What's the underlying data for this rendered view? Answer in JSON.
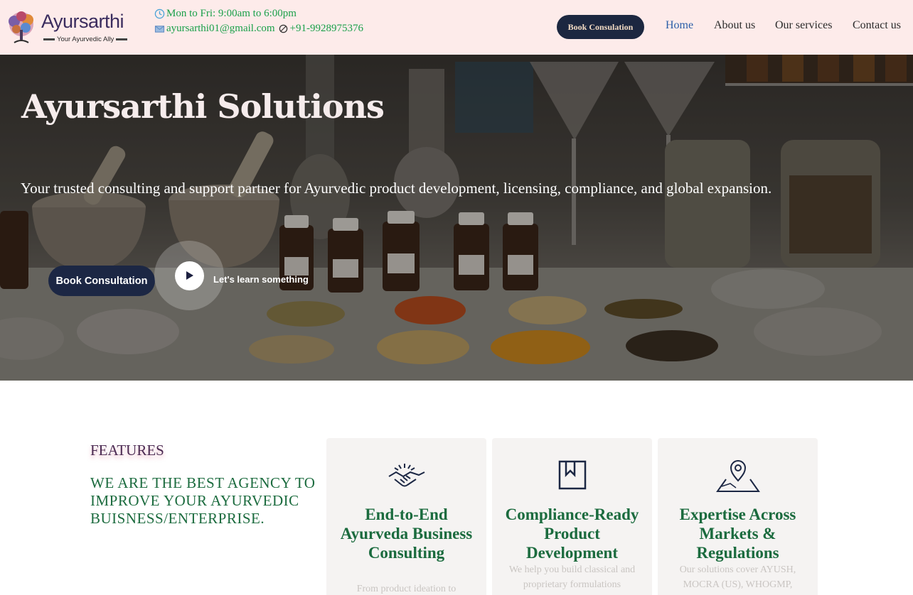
{
  "header": {
    "logo_word": "Ayursarthi",
    "logo_tagline": "Your Ayurvedic Ally",
    "hours": "Mon to Fri: 9:00am to 6:00pm",
    "email": "ayursarthi01@gmail.com",
    "phone": "+91-9928975376",
    "book_button": "Book Consulation",
    "nav": [
      "Home",
      "About us",
      "Our services",
      "Contact us"
    ],
    "active_nav": "Home"
  },
  "hero": {
    "title": "Ayursarthi Solutions",
    "subtitle": "Your trusted consulting and support partner for Ayurvedic product development, licensing, compliance, and global expansion.",
    "button": "Book Consultation",
    "learn_text": "Let's learn something"
  },
  "features": {
    "label": "FEATURES",
    "heading": "WE ARE THE BEST AGENCY TO IMPROVE YOUR AYURVEDIC BUISNESS/ENTERPRISE.",
    "cards": [
      {
        "icon": "handshake-icon",
        "title": "End-to-End Ayurveda Business Consulting",
        "text": "From product ideation to"
      },
      {
        "icon": "bookmark-book-icon",
        "title": "Compliance-Ready Product Development",
        "text": "We help you build classical and proprietary formulations"
      },
      {
        "icon": "map-pin-icon",
        "title": "Expertise Across Markets & Regulations",
        "text": "Our solutions cover AYUSH, MOCRA (US), WHOGMP,"
      }
    ]
  },
  "colors": {
    "header_bg": "#fdebea",
    "navy": "#1c2740",
    "green_accent": "#1b6b3e",
    "contact_green": "#1aa04a",
    "nav_active": "#2a5ea8"
  }
}
